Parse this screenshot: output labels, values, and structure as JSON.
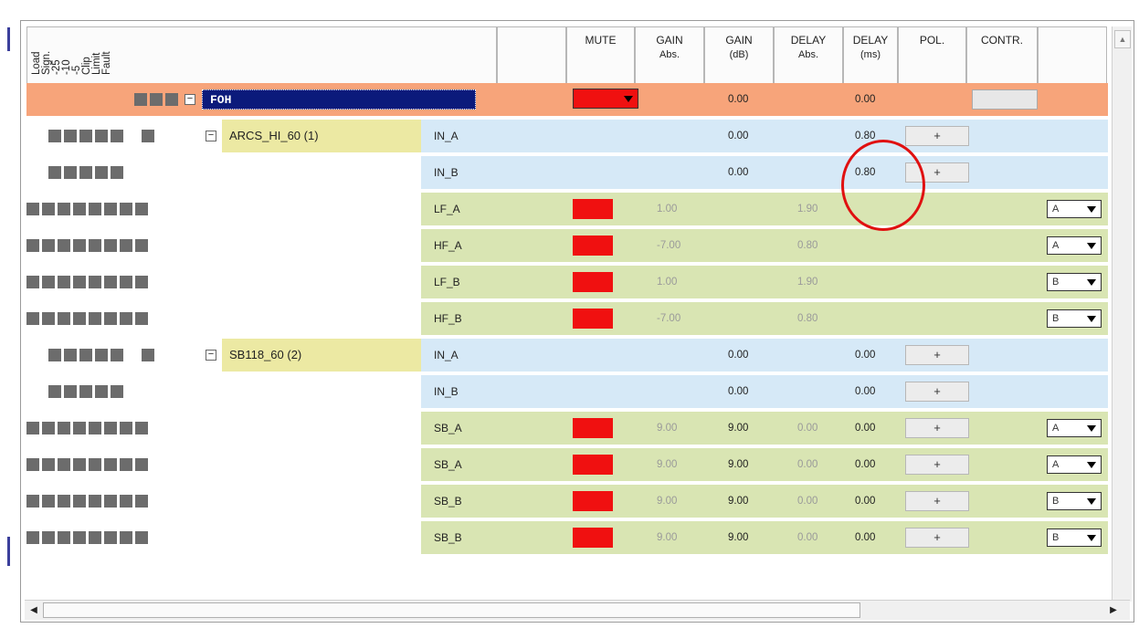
{
  "header": {
    "meter_labels": [
      "Load",
      "Sign.",
      "-25",
      "-10",
      "-5",
      "Clip",
      "Limit",
      "Fault"
    ],
    "mute": "MUTE",
    "gain_abs": "GAIN",
    "gain_abs_sub": "Abs.",
    "gain_db": "GAIN",
    "gain_db_sub": "(dB)",
    "delay_abs": "DELAY",
    "delay_abs_sub": "Abs.",
    "delay_ms": "DELAY",
    "delay_ms_sub": "(ms)",
    "pol": "POL.",
    "contr": "CONTR."
  },
  "colors": {
    "group_row": "#f7a47a",
    "input_row": "#d6e9f7",
    "output_row": "#d9e5b3",
    "device_name": "#ece9a3",
    "mute_red": "#f01010",
    "annotation_circle": "#e01010"
  },
  "rows": [
    {
      "type": "group",
      "name": "FOH",
      "gain_db": "0.00",
      "delay_ms": "0.00"
    },
    {
      "type": "input",
      "device": "ARCS_HI_60 (1)",
      "channel": "IN_A",
      "gain_db": "0.00",
      "delay_ms": "0.80",
      "pol": "+"
    },
    {
      "type": "input",
      "channel": "IN_B",
      "gain_db": "0.00",
      "delay_ms": "0.80",
      "pol": "+"
    },
    {
      "type": "output",
      "channel": "LF_A",
      "gain_abs": "1.00",
      "delay_abs": "1.90",
      "select": "A"
    },
    {
      "type": "output",
      "channel": "HF_A",
      "gain_abs": "-7.00",
      "delay_abs": "0.80",
      "select": "A"
    },
    {
      "type": "output",
      "channel": "LF_B",
      "gain_abs": "1.00",
      "delay_abs": "1.90",
      "select": "B"
    },
    {
      "type": "output",
      "channel": "HF_B",
      "gain_abs": "-7.00",
      "delay_abs": "0.80",
      "select": "B"
    },
    {
      "type": "input",
      "device": "SB118_60 (2)",
      "channel": "IN_A",
      "gain_db": "0.00",
      "delay_ms": "0.00",
      "pol": "+"
    },
    {
      "type": "input",
      "channel": "IN_B",
      "gain_db": "0.00",
      "delay_ms": "0.00",
      "pol": "+"
    },
    {
      "type": "output",
      "channel": "SB_A",
      "gain_abs": "9.00",
      "gain_db": "9.00",
      "delay_abs": "0.00",
      "delay_ms": "0.00",
      "pol": "+",
      "select": "A"
    },
    {
      "type": "output",
      "channel": "SB_A",
      "gain_abs": "9.00",
      "gain_db": "9.00",
      "delay_abs": "0.00",
      "delay_ms": "0.00",
      "pol": "+",
      "select": "A"
    },
    {
      "type": "output",
      "channel": "SB_B",
      "gain_abs": "9.00",
      "gain_db": "9.00",
      "delay_abs": "0.00",
      "delay_ms": "0.00",
      "pol": "+",
      "select": "B"
    },
    {
      "type": "output",
      "channel": "SB_B",
      "gain_abs": "9.00",
      "gain_db": "9.00",
      "delay_abs": "0.00",
      "delay_ms": "0.00",
      "pol": "+",
      "select": "B"
    }
  ]
}
